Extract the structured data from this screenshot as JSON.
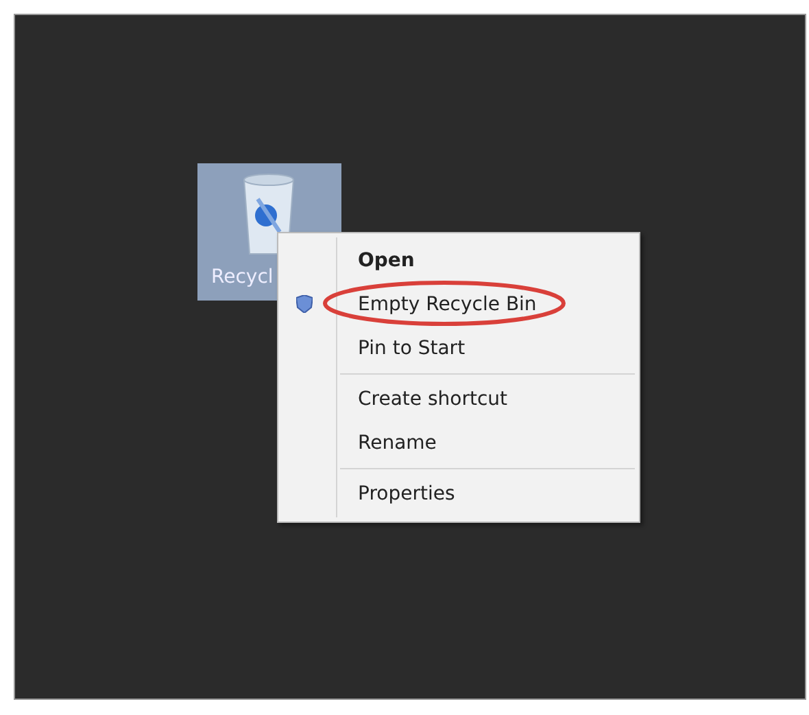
{
  "desktop_icon": {
    "label": "Recycl",
    "selected": true
  },
  "context_menu": {
    "items": [
      {
        "kind": "item",
        "label": "Open",
        "default": true
      },
      {
        "kind": "item",
        "label": "Empty Recycle Bin",
        "shield": true,
        "circled": true
      },
      {
        "kind": "item",
        "label": "Pin to Start"
      },
      {
        "kind": "separator"
      },
      {
        "kind": "item",
        "label": "Create shortcut"
      },
      {
        "kind": "item",
        "label": "Rename"
      },
      {
        "kind": "separator"
      },
      {
        "kind": "item",
        "label": "Properties"
      }
    ]
  }
}
